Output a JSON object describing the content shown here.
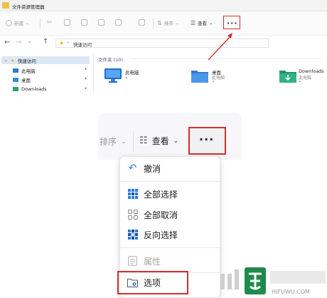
{
  "window": {
    "title": "文件资源管理器"
  },
  "toolbar": {
    "new_label": "新建",
    "sort_label": "排序",
    "view_label": "查看",
    "more_label": "···"
  },
  "address": {
    "path": "快速访问"
  },
  "sidebar": {
    "items": [
      {
        "label": "快速访问",
        "icon": "star-icon"
      },
      {
        "label": "此电脑",
        "icon": "computer-icon"
      },
      {
        "label": "桌面",
        "icon": "desktop-icon"
      },
      {
        "label": "Downloads",
        "icon": "download-icon"
      }
    ]
  },
  "content": {
    "group_header": "文件夹 (10)",
    "files": [
      {
        "name": "此电脑",
        "sub": "",
        "icon": "computer-icon"
      },
      {
        "name": "桌面",
        "sub": "此电脑",
        "icon": "desktop-folder-icon"
      },
      {
        "name": "Downloads",
        "sub": "此电脑",
        "icon": "downloads-folder-icon"
      }
    ]
  },
  "zoom": {
    "sort_label": "排序",
    "view_label": "查看",
    "more_label": "···",
    "menu": [
      {
        "label": "撤消",
        "icon": "undo-icon",
        "disabled": false
      },
      {
        "label": "全部选择",
        "icon": "select-all-icon",
        "disabled": false
      },
      {
        "label": "全部取消",
        "icon": "select-none-icon",
        "disabled": false
      },
      {
        "label": "反向选择",
        "icon": "invert-selection-icon",
        "disabled": false
      },
      {
        "label": "属性",
        "icon": "properties-icon",
        "disabled": true
      },
      {
        "label": "选项",
        "icon": "options-icon",
        "disabled": false
      }
    ]
  },
  "watermark": {
    "text": "HIFUWU.COM"
  },
  "colors": {
    "highlight": "#d32f2f",
    "accent_blue": "#2e7bd6",
    "folder_yellow": "#f0c24b",
    "green_folder": "#27a37a"
  }
}
